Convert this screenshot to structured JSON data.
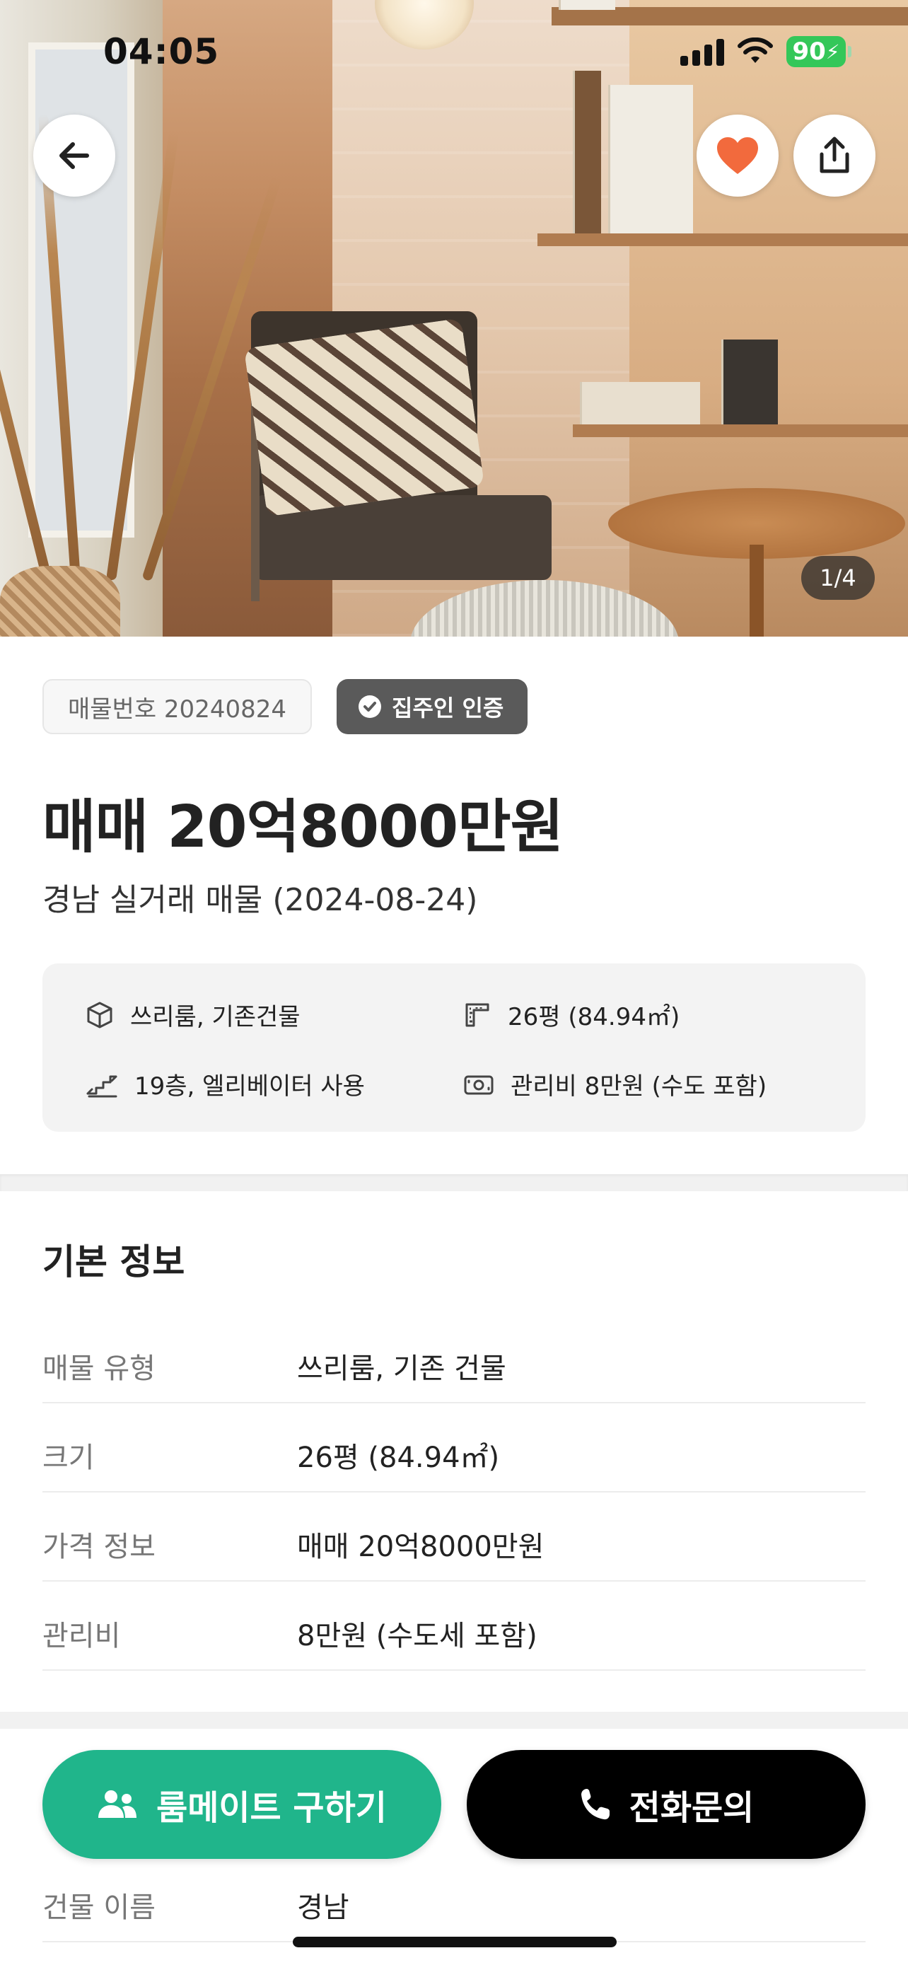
{
  "status_bar": {
    "time": "04:05",
    "battery": "90"
  },
  "hero": {
    "photo_counter": "1/4"
  },
  "listing": {
    "tag": "매물번호 20240824",
    "verified_badge": "집주인 인증",
    "price_title": "매매 20억8000만원",
    "subtitle": "경남 실거래 매물 (2024-08-24)",
    "features": [
      {
        "icon": "cube-icon",
        "text": "쓰리룸, 기존건물"
      },
      {
        "icon": "floorplan-icon",
        "text": "26평 (84.94㎡)"
      },
      {
        "icon": "stairs-icon",
        "text": "19층, 엘리베이터 사용"
      },
      {
        "icon": "cash-icon",
        "text": "관리비 8만원 (수도 포함)"
      }
    ]
  },
  "basic_info": {
    "title": "기본 정보",
    "rows": [
      {
        "label": "매물 유형",
        "value": "쓰리룸, 기존 건물"
      },
      {
        "label": "크기",
        "value": "26평 (84.94㎡)"
      },
      {
        "label": "가격 정보",
        "value": "매매 20억8000만원"
      },
      {
        "label": "관리비",
        "value": "8만원 (수도세 포함)"
      },
      {
        "label": "건물 이름",
        "value": "경남"
      }
    ]
  },
  "actions": {
    "roommate": "룸메이트 구하기",
    "call": "전화문의"
  },
  "colors": {
    "accent_green": "#20b58b",
    "heart_orange": "#f26a3d",
    "battery_green": "#34c759"
  }
}
